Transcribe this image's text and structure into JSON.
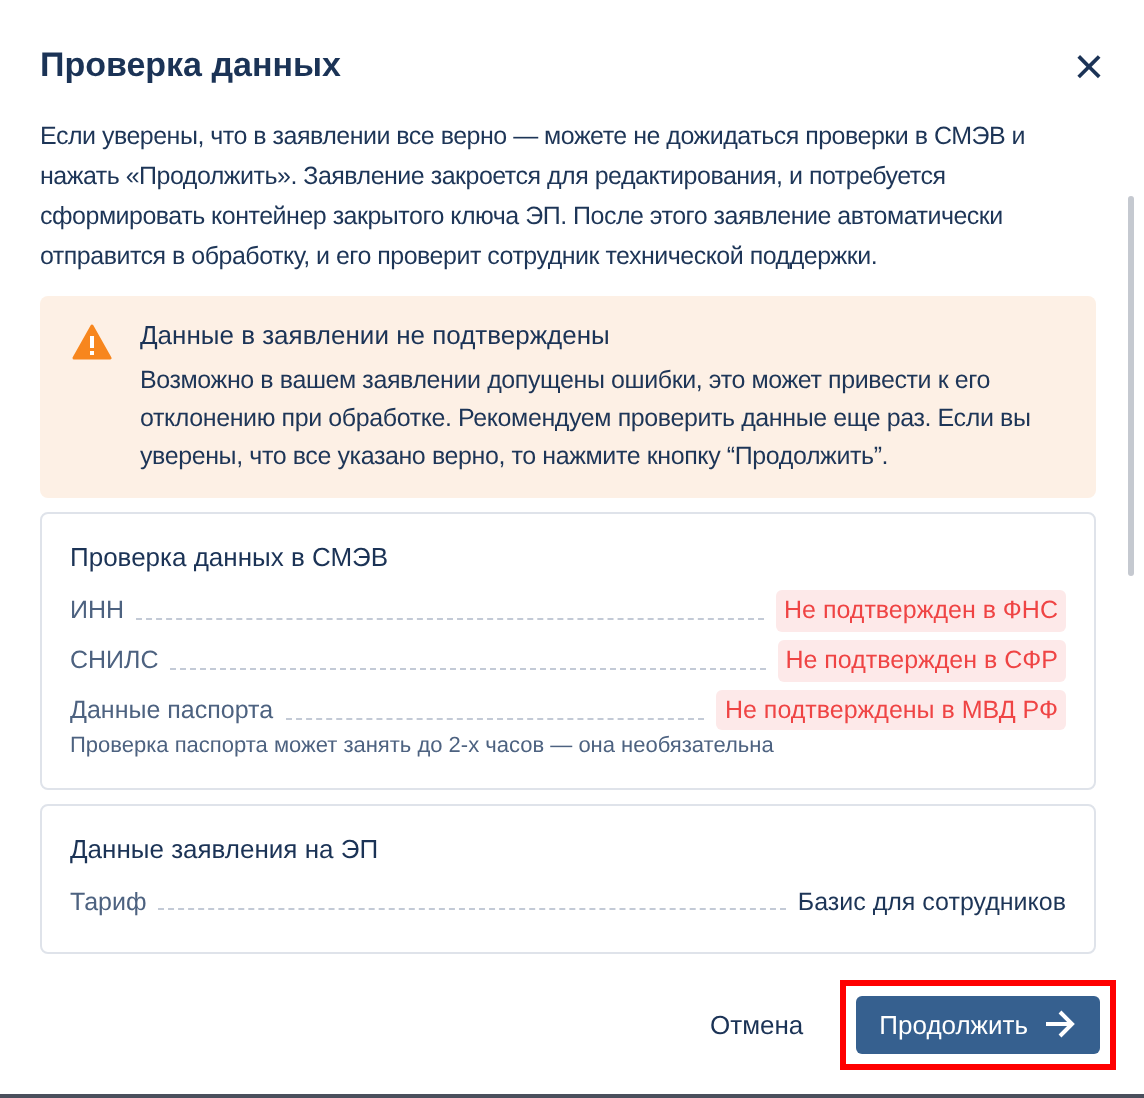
{
  "dialog": {
    "title": "Проверка данных",
    "close": "×"
  },
  "intro": "Если уверены, что в заявлении все верно — можете не дожидаться проверки в СМЭВ и нажать «Продолжить». Заявление закроется для редактирования, и потребуется сформировать контейнер закрытого ключа ЭП. После этого заявление автоматически отправится в обработку, и его проверит сотрудник технической поддержки.",
  "alert": {
    "title": "Данные в заявлении не подтверждены",
    "text": "Возможно в вашем заявлении допущены ошибки, это может привести к его отклонению при обработке. Рекомендуем проверить данные еще раз. Если вы уверены, что все указано верно, то нажмите кнопку “Продолжить”."
  },
  "sections": [
    {
      "title": "Проверка данных в СМЭВ",
      "rows": [
        {
          "label": "ИНН",
          "value": "Не подтвержден в ФНС",
          "kind": "error"
        },
        {
          "label": "СНИЛС",
          "value": "Не подтвержден в СФР",
          "kind": "error"
        },
        {
          "label": "Данные паспорта",
          "value": "Не подтверждены в МВД РФ",
          "kind": "error",
          "note": "Проверка паспорта может занять до 2-х часов — она необязательна"
        }
      ]
    },
    {
      "title": "Данные заявления на ЭП",
      "rows": [
        {
          "label": "Тариф",
          "value": "Базис для сотрудников",
          "kind": "plain"
        }
      ]
    }
  ],
  "buttons": [
    {
      "label": "Отмена",
      "kind": "link",
      "highlighted": false
    },
    {
      "label": "Продолжить",
      "kind": "primary",
      "highlighted": true
    }
  ]
}
